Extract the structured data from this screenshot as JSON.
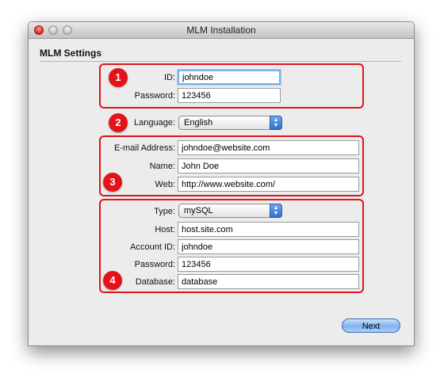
{
  "window": {
    "title": "MLM Installation"
  },
  "section": {
    "title": "MLM Settings"
  },
  "badges": [
    "1",
    "2",
    "3",
    "4"
  ],
  "account": {
    "id_label": "ID:",
    "id_value": "johndoe",
    "password_label": "Password:",
    "password_value": "123456"
  },
  "language": {
    "label": "Language:",
    "value": "English"
  },
  "profile": {
    "email_label": "E-mail Address:",
    "email_value": "johndoe@website.com",
    "name_label": "Name:",
    "name_value": "John Doe",
    "web_label": "Web:",
    "web_value": "http://www.website.com/"
  },
  "database": {
    "type_label": "Type:",
    "type_value": "mySQL",
    "host_label": "Host:",
    "host_value": "host.site.com",
    "account_label": "Account ID:",
    "account_value": "johndoe",
    "password_label": "Password:",
    "password_value": "123456",
    "database_label": "Database:",
    "database_value": "database"
  },
  "buttons": {
    "next": "Next"
  },
  "colors": {
    "highlight": "#e0141b",
    "badge": "#e3131a",
    "focus": "#7ab0e8"
  }
}
